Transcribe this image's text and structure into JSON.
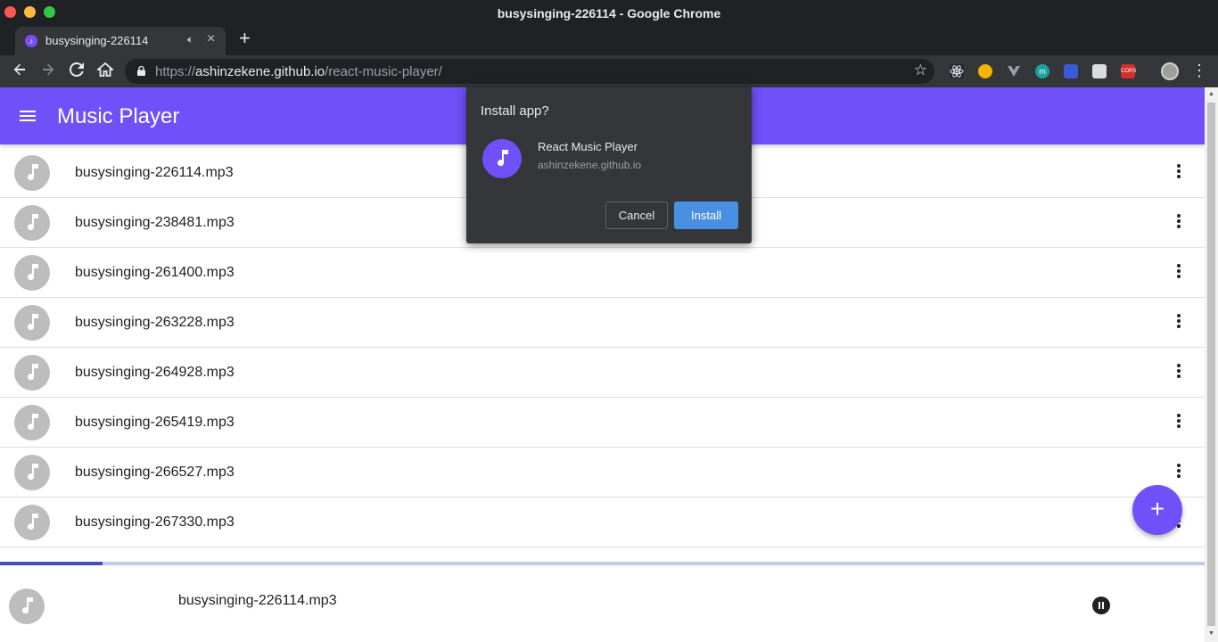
{
  "window": {
    "title": "busysinging-226114 - Google Chrome"
  },
  "tab": {
    "title": "busysinging-226114"
  },
  "address_bar": {
    "scheme": "https://",
    "host": "ashinzekene.github.io",
    "path": "/react-music-player/"
  },
  "extensions": [
    {
      "name": "react-devtools-icon",
      "color": "#23272f"
    },
    {
      "name": "yellow-circle-extension-icon",
      "color": "#f4b400"
    },
    {
      "name": "vue-devtools-icon",
      "color": "#35363a"
    },
    {
      "name": "m-extension-icon",
      "color": "#1aa39a"
    },
    {
      "name": "blue-extension-icon",
      "color": "#3b5bdb"
    },
    {
      "name": "grey-extension-icon",
      "color": "#dadce0"
    },
    {
      "name": "cors-extension-icon",
      "color": "#d32f2f",
      "label": "CORS"
    }
  ],
  "app": {
    "title": "Music Player",
    "accent": "#7050f9",
    "songs": [
      "busysinging-226114.mp3",
      "busysinging-238481.mp3",
      "busysinging-261400.mp3",
      "busysinging-263228.mp3",
      "busysinging-264928.mp3",
      "busysinging-265419.mp3",
      "busysinging-266527.mp3",
      "busysinging-267330.mp3"
    ]
  },
  "player": {
    "now_playing": "busysinging-226114.mp3",
    "progress_fraction": 0.085
  },
  "install_dialog": {
    "title": "Install app?",
    "app_name": "React Music Player",
    "origin": "ashinzekene.github.io",
    "cancel_label": "Cancel",
    "install_label": "Install"
  }
}
